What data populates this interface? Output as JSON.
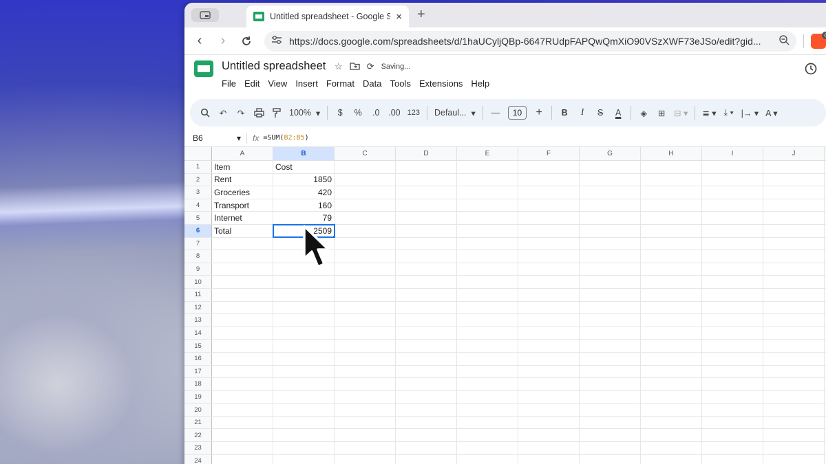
{
  "browser": {
    "tab_title": "Untitled spreadsheet - Google Sheets",
    "tab_close": "×",
    "new_tab": "+",
    "url": "https://docs.google.com/spreadsheets/d/1haUCyljQBp-6647RUdpFAPQwQmXiO90VSzXWF73eJSo/edit?gid...",
    "brave_badge": "4"
  },
  "doc": {
    "title": "Untitled spreadsheet",
    "status": "Saving...",
    "menu": [
      "File",
      "Edit",
      "View",
      "Insert",
      "Format",
      "Data",
      "Tools",
      "Extensions",
      "Help"
    ]
  },
  "toolbar": {
    "zoom": "100%",
    "currency": "$",
    "percent": "%",
    "dec_decrease": ".0",
    "dec_increase": ".00",
    "number_format": "123",
    "font": "Defaul...",
    "font_size": "10",
    "bold": "B",
    "italic": "I"
  },
  "formula_bar": {
    "name_box": "B6",
    "fx": "fx",
    "formula_prefix": "=SUM(",
    "formula_ref": "B2:B5",
    "formula_suffix": ")"
  },
  "sheet": {
    "columns": [
      "A",
      "B",
      "C",
      "D",
      "E",
      "F",
      "G",
      "H",
      "I",
      "J"
    ],
    "selected_column": "B",
    "selected_row": 6,
    "rows": [
      {
        "num": "1",
        "a": "Item",
        "b": "Cost"
      },
      {
        "num": "2",
        "a": "Rent",
        "b": "1850"
      },
      {
        "num": "3",
        "a": "Groceries",
        "b": "420"
      },
      {
        "num": "4",
        "a": "Transport",
        "b": "160"
      },
      {
        "num": "5",
        "a": "Internet",
        "b": "79"
      },
      {
        "num": "6",
        "a": "Total",
        "b": "2509"
      },
      {
        "num": "7",
        "a": "",
        "b": ""
      },
      {
        "num": "8",
        "a": "",
        "b": ""
      },
      {
        "num": "9",
        "a": "",
        "b": ""
      },
      {
        "num": "10",
        "a": "",
        "b": ""
      },
      {
        "num": "11",
        "a": "",
        "b": ""
      },
      {
        "num": "12",
        "a": "",
        "b": ""
      },
      {
        "num": "13",
        "a": "",
        "b": ""
      },
      {
        "num": "14",
        "a": "",
        "b": ""
      },
      {
        "num": "15",
        "a": "",
        "b": ""
      },
      {
        "num": "16",
        "a": "",
        "b": ""
      },
      {
        "num": "17",
        "a": "",
        "b": ""
      },
      {
        "num": "18",
        "a": "",
        "b": ""
      },
      {
        "num": "19",
        "a": "",
        "b": ""
      },
      {
        "num": "20",
        "a": "",
        "b": ""
      },
      {
        "num": "21",
        "a": "",
        "b": ""
      },
      {
        "num": "22",
        "a": "",
        "b": ""
      },
      {
        "num": "23",
        "a": "",
        "b": ""
      },
      {
        "num": "24",
        "a": "",
        "b": ""
      }
    ]
  },
  "colors": {
    "accent": "#1a73e8",
    "sheets_green": "#1fa463",
    "selection_header": "#d3e3fd"
  }
}
